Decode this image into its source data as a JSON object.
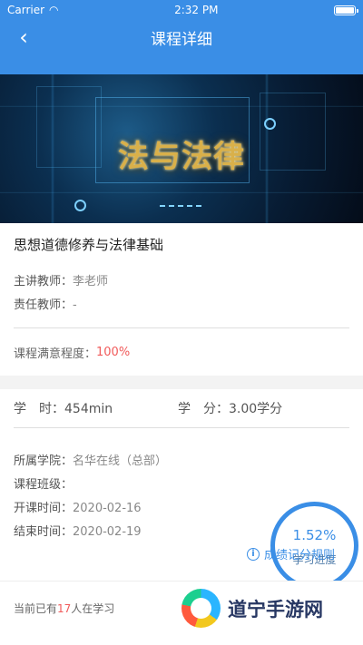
{
  "status": {
    "carrier": "Carrier",
    "time": "2:32 PM"
  },
  "nav": {
    "back_icon": "chevron-left-icon",
    "title": "课程详细"
  },
  "banner": {
    "title": "法与法律"
  },
  "course": {
    "title": "思想道德修养与法律基础",
    "teacher_label": "主讲教师：",
    "teacher": "李老师",
    "responsible_label": "责任教师：",
    "responsible": "-",
    "satisfaction_label": "课程满意程度：",
    "satisfaction": "100%"
  },
  "credits": {
    "hours_label": "学　时：",
    "hours": "454min",
    "credit_label": "学　分：",
    "credit": "3.00学分"
  },
  "details": {
    "college_label": "所属学院：",
    "college": "名华在线（总部）",
    "class_label": "课程班级：",
    "class": "",
    "start_label": "开课时间：",
    "start": "2020-02-16",
    "end_label": "结束时间：",
    "end": "2020-02-19"
  },
  "progress": {
    "value": "1.52%",
    "label": "学习进度"
  },
  "rules": {
    "icon": "info-icon",
    "label": "成绩记分规则"
  },
  "bottom": {
    "prefix": "当前已有",
    "count": "17",
    "suffix": "人在学习"
  },
  "watermark": {
    "text": "道宁手游网"
  },
  "colors": {
    "accent": "#3a8ee6",
    "highlight": "#f15b5b"
  }
}
